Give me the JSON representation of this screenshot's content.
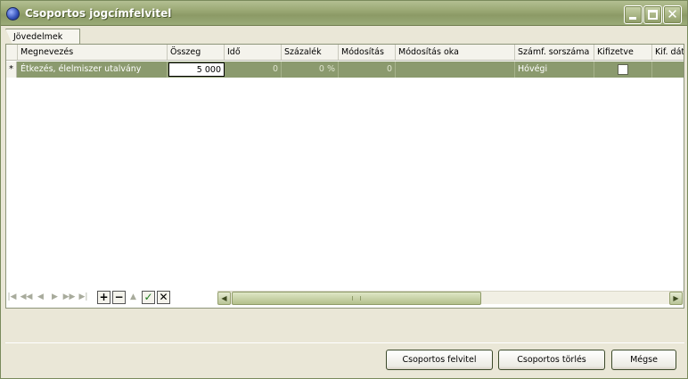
{
  "window": {
    "title": "Csoportos jogcímfelvitel",
    "accent_color": "#8b9a6e"
  },
  "tabs": [
    {
      "label": "Jövedelmek",
      "active": true
    }
  ],
  "grid": {
    "columns": [
      "Megnevezés",
      "Összeg",
      "Idő",
      "Százalék",
      "Módosítás",
      "Módosítás oka",
      "Számf. sorszáma",
      "Kifizetve",
      "Kif. dát"
    ],
    "row_indicator": "*",
    "rows": [
      {
        "megnevezes": "Étkezés, élelmiszer utalvány",
        "osszeg": "5 000",
        "ido": "0",
        "szazalek": "0 %",
        "modositas": "0",
        "modositas_oka": "",
        "szamf_sorszama": "Hóvégi",
        "kifizetve": false,
        "kif_datum": ""
      }
    ]
  },
  "navigator": {
    "buttons": [
      "first-icon",
      "prior-page-icon",
      "prior-icon",
      "next-icon",
      "next-page-icon",
      "last-icon",
      "insert-icon",
      "delete-icon",
      "edit-icon",
      "post-icon",
      "cancel-icon"
    ],
    "labels": {
      "insert": "+",
      "delete": "−",
      "post": "✓",
      "cancel": "✕"
    }
  },
  "buttons": {
    "group_add": "Csoportos felvitel",
    "group_delete": "Csoportos törlés",
    "cancel": "Mégse"
  }
}
